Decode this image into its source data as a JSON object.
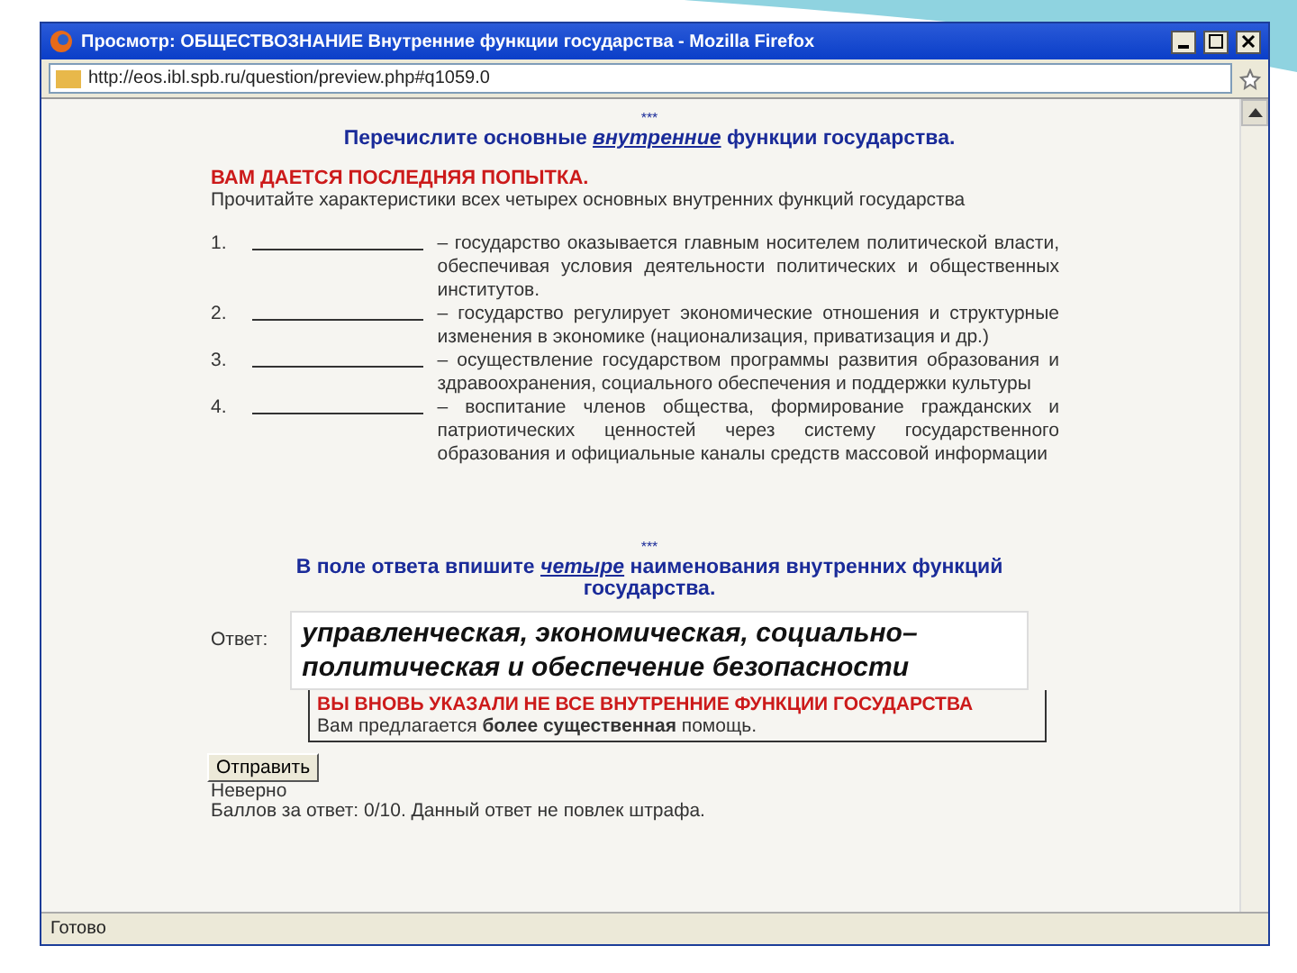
{
  "window": {
    "title": "Просмотр: ОБЩЕСТВОЗНАНИЕ Внутренние функции государства - Mozilla Firefox"
  },
  "address_bar": {
    "url": "http://eos.ibl.spb.ru/question/preview.php#q1059.0"
  },
  "question": {
    "separator": "***",
    "prompt": "Перечислите основные *внутренние* функции государства.",
    "attempt_notice": "ВАМ ДАЕТСЯ ПОСЛЕДНЯЯ ПОПЫТКА.",
    "instructions": "Прочитайте характеристики всех четырех основных внутренних функций государства",
    "items": [
      {
        "number": "1.",
        "text": "– государство оказывается главным носителем политической власти, обеспечивая условия деятельности политических и общественных институтов."
      },
      {
        "number": "2.",
        "text": "– государство регулирует экономические отношения и структурные изменения в экономике (национализация, приватизация и др.)"
      },
      {
        "number": "3.",
        "text": "– осуществление государством программы развития образования и здравоохранения, социального обеспечения и поддержки культуры"
      },
      {
        "number": "4.",
        "text": "– воспитание членов общества, формирование гражданских и патриотических ценностей через систему государственного образования и официальные каналы средств массовой информации"
      }
    ]
  },
  "answer_section": {
    "separator": "***",
    "prompt": "В поле ответа впишите *четыре* наименования внутренних функций государства.",
    "label": "Ответ:",
    "value": "управленческая, экономическая, социально–политическая и обеспечение безопасности"
  },
  "feedback": {
    "title": "ВЫ ВНОВЬ УКАЗАЛИ НЕ ВСЕ ВНУТРЕННИЕ ФУНКЦИИ ГОСУДАРСТВА",
    "message": "Вам предлагается **более существенная** помощь."
  },
  "submit_button": "Отправить",
  "result": {
    "status": "Неверно",
    "score": "Баллов за ответ: 0/10. Данный ответ не повлек штрафа."
  },
  "status_bar": "Готово"
}
